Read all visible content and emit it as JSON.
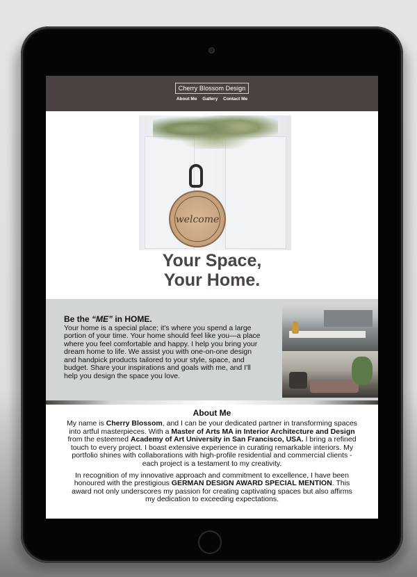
{
  "header": {
    "brand": "Cherry Blossom Design",
    "nav": [
      "About Me",
      "Gallery",
      "Contact Me"
    ]
  },
  "hero": {
    "sign_text": "welcome",
    "title_line1": "Your Space,",
    "title_line2": "Your Home."
  },
  "intro": {
    "heading_prefix": "Be the ",
    "heading_emphasis": "“ME”",
    "heading_suffix": " in HOME.",
    "body": "Your home is a special place; it's where you spend a large portion of your time. Your home should feel like you—a place where you feel comfortable and happy. I help you bring your dream home to life. We assist you with one-on-one design and handpick products tailored to your style, space, and budget. Share your inspirations and goals with me, and I'll help you design the space you love."
  },
  "about": {
    "title": "About Me",
    "p1": {
      "t1": "My name is ",
      "b1": "Cherry Blossom",
      "t2": ", and I can be your dedicated partner in transforming spaces into artful masterpieces. With a ",
      "b2": "Master of Arts MA in Interior Architecture and Design",
      "t3": " from the esteemed ",
      "b3": "Academy of Art University in San Francisco, USA.",
      "t4": " I bring a refined touch to every project. I boast extensive experience in curating remarkable interiors. My portfolio shines with collaborations with high-profile residential and commercial clients - each project is a testament to my creativity."
    },
    "p2": {
      "t1": "In recognition of my innovative approach and commitment to excellence, I have been honoured with the prestigious ",
      "b1": "GERMAN DESIGN AWARD SPECIAL MENTION",
      "t2": ". This award not only underscores my passion for creating captivating spaces but also affirms my dedication to exceeding expectations."
    }
  },
  "colors": {
    "header_bg": "#4a4240",
    "intro_bg": "#d1d5d6",
    "title_color": "#4a4442"
  }
}
